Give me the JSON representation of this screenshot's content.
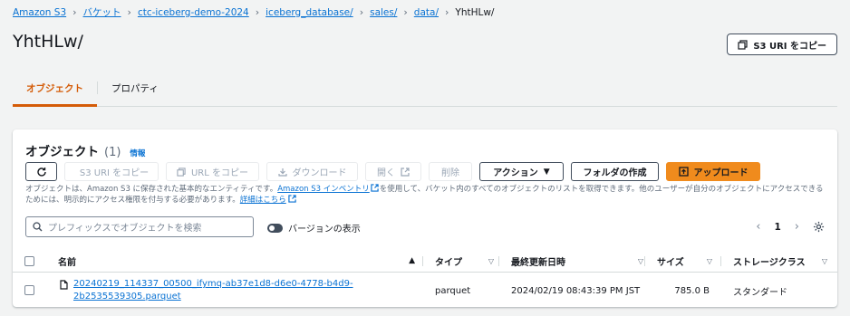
{
  "breadcrumb": [
    "Amazon S3",
    "バケット",
    "ctc-iceberg-demo-2024",
    "iceberg_database/",
    "sales/",
    "data/",
    "YhtHLw/"
  ],
  "page_title": "YhtHLw/",
  "copy_s3_uri_label": "S3 URI をコピー",
  "tabs": [
    "オブジェクト",
    "プロパティ"
  ],
  "panel": {
    "title": "オブジェクト",
    "count": "(1)",
    "info": "情報"
  },
  "buttons": {
    "refresh": "",
    "copy_s3_uri": "S3 URI をコピー",
    "copy_url": "URL をコピー",
    "download": "ダウンロード",
    "open": "開く",
    "delete": "削除",
    "actions": "アクション",
    "create_folder": "フォルダの作成",
    "upload": "アップロード"
  },
  "description": {
    "part1": "オブジェクトは、Amazon S3 に保存された基本的なエンティティです。",
    "link1": "Amazon S3 インベントリ",
    "part2": "を使用して、バケット内のすべてのオブジェクトのリストを取得できます。他のユーザーが自分のオブジェクトにアクセスできるためには、明示的にアクセス権限を付与する必要があります。",
    "link2": "詳細はこちら"
  },
  "search": {
    "placeholder": "プレフィックスでオブジェクトを検索"
  },
  "versions_toggle_label": "バージョンの表示",
  "pagination": {
    "page": "1"
  },
  "table": {
    "columns": [
      "名前",
      "タイプ",
      "最終更新日時",
      "サイズ",
      "ストレージクラス"
    ],
    "rows": [
      {
        "name_line1": "20240219_114337_00500_ifymq-ab37e1d8-d6e0-4778-b4d9-",
        "name_line2": "2b2535539305.parquet",
        "type": "parquet",
        "modified": "2024/02/19 08:43:39 PM JST",
        "size": "785.0 B",
        "storage_class": "スタンダード"
      }
    ]
  },
  "colors": {
    "link": "#0972d3",
    "accent": "#d45b07",
    "primary_button": "#f08b1d"
  }
}
